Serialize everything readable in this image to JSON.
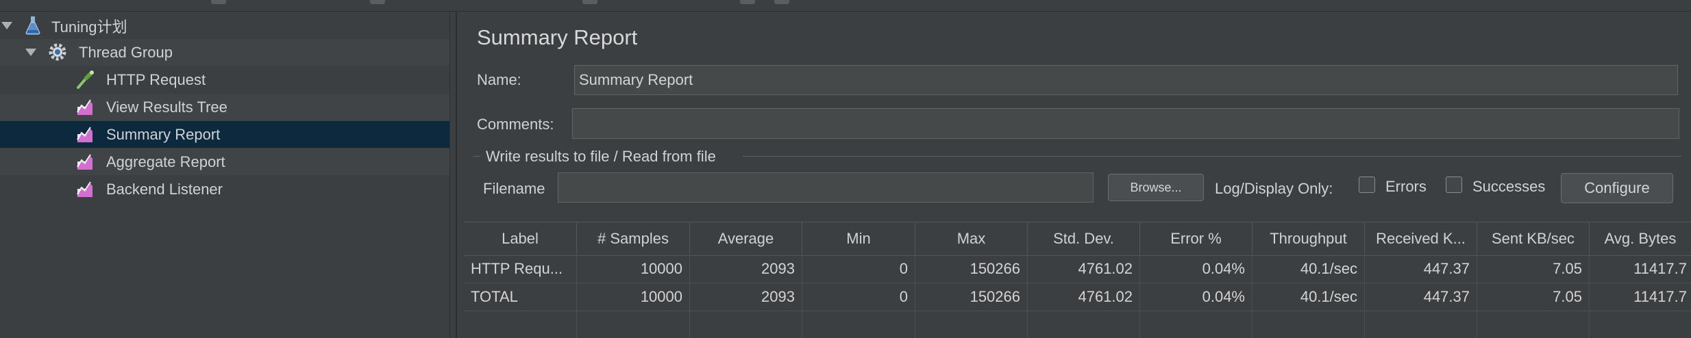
{
  "tree": {
    "items": [
      {
        "label": "Tuning计划",
        "icon": "test-plan-flask-icon"
      },
      {
        "label": "Thread Group",
        "icon": "thread-group-gear-icon"
      },
      {
        "label": "HTTP Request",
        "icon": "http-request-pipette-icon"
      },
      {
        "label": "View Results Tree",
        "icon": "listener-chart-icon"
      },
      {
        "label": "Summary Report",
        "icon": "listener-chart-icon"
      },
      {
        "label": "Aggregate Report",
        "icon": "listener-chart-icon"
      },
      {
        "label": "Backend Listener",
        "icon": "listener-chart-icon"
      }
    ],
    "selected_index": 4
  },
  "panel": {
    "title": "Summary Report",
    "name_label": "Name:",
    "name_value": "Summary Report",
    "comments_label": "Comments:",
    "comments_value": "",
    "fileset_title": "Write results to file / Read from file",
    "filename_label": "Filename",
    "filename_value": "",
    "browse_label": "Browse...",
    "log_display_label": "Log/Display Only:",
    "errors_label": "Errors",
    "successes_label": "Successes",
    "configure_label": "Configure"
  },
  "table": {
    "columns": [
      "Label",
      "# Samples",
      "Average",
      "Min",
      "Max",
      "Std. Dev.",
      "Error %",
      "Throughput",
      "Received K...",
      "Sent KB/sec",
      "Avg. Bytes"
    ],
    "rows": [
      [
        "HTTP Requ...",
        "10000",
        "2093",
        "0",
        "150266",
        "4761.02",
        "0.04%",
        "40.1/sec",
        "447.37",
        "7.05",
        "11417.7"
      ],
      [
        "TOTAL",
        "10000",
        "2093",
        "0",
        "150266",
        "4761.02",
        "0.04%",
        "40.1/sec",
        "447.37",
        "7.05",
        "11417.7"
      ]
    ]
  },
  "colors": {
    "background": "#3c3f41",
    "selection": "#0d293e",
    "text": "#cfd2d6"
  }
}
